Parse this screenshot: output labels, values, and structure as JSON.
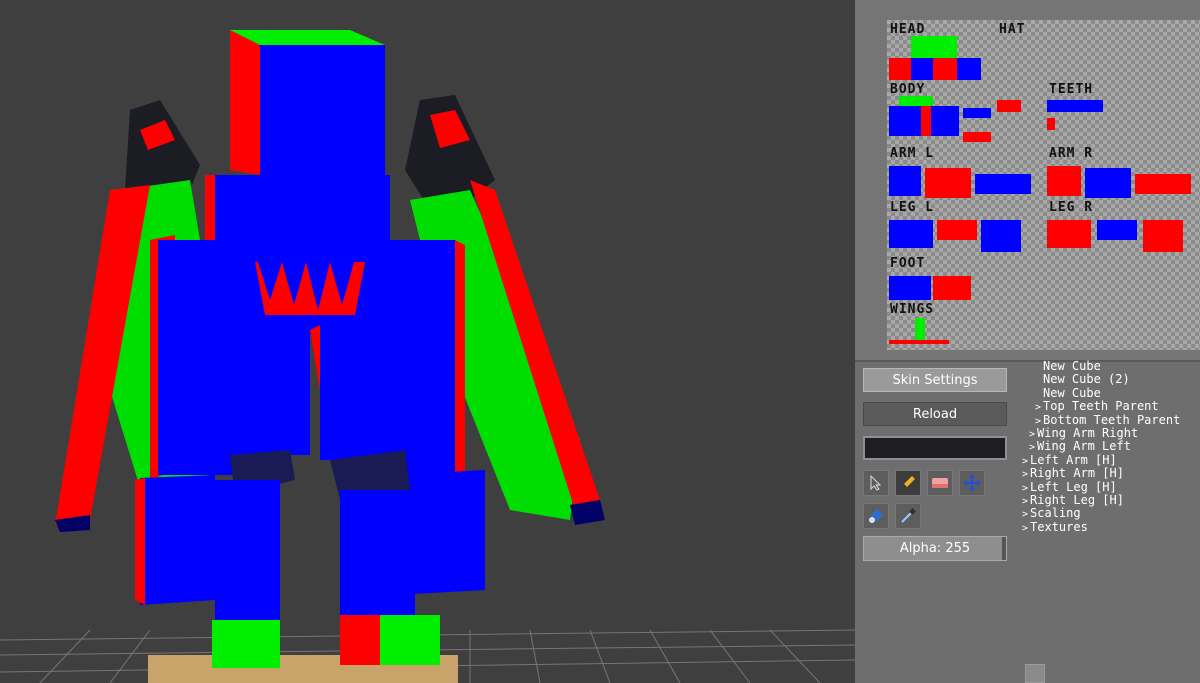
{
  "viewport": {
    "model": "3d-character-model",
    "colors": {
      "blue": "#0000ff",
      "red": "#ff0000",
      "green": "#00ee00",
      "dark": "#1c1c24",
      "navy": "#000055",
      "grid": "#7a7a7a",
      "platform": "#c8a46a"
    }
  },
  "texture": {
    "labels": {
      "head": "HEAD",
      "hat": "HAT",
      "body": "BODY",
      "teeth": "TEETH",
      "arm_l": "ARM L",
      "arm_r": "ARM R",
      "leg_l": "LEG L",
      "leg_r": "LEG R",
      "foot": "FOOT",
      "wings": "WINGS"
    }
  },
  "controls": {
    "skin_settings": "Skin Settings",
    "reload": "Reload",
    "alpha": "Alpha: 255",
    "alpha_value": 255,
    "color_value": "#1d1d22"
  },
  "tools": [
    "select-icon",
    "pencil-icon",
    "eraser-icon",
    "move-icon",
    "fill-bucket-icon",
    "eyedropper-icon"
  ],
  "outliner": {
    "items": [
      {
        "label": "New Cube",
        "caret": ""
      },
      {
        "label": "New Cube (2)",
        "caret": ""
      },
      {
        "label": "New Cube",
        "caret": ""
      },
      {
        "label": "Top Teeth Parent",
        "caret": ">"
      },
      {
        "label": "Bottom Teeth Parent",
        "caret": ">"
      },
      {
        "label": "Wing Arm Right",
        "caret": ">"
      },
      {
        "label": "Wing Arm Left",
        "caret": ">"
      },
      {
        "label": "Left Arm [H]",
        "caret": ">"
      },
      {
        "label": "Right Arm [H]",
        "caret": ">"
      },
      {
        "label": "Left Leg [H]",
        "caret": ">"
      },
      {
        "label": "Right Leg [H]",
        "caret": ">"
      },
      {
        "label": "Scaling",
        "caret": ">"
      },
      {
        "label": "Textures",
        "caret": ">"
      }
    ]
  }
}
